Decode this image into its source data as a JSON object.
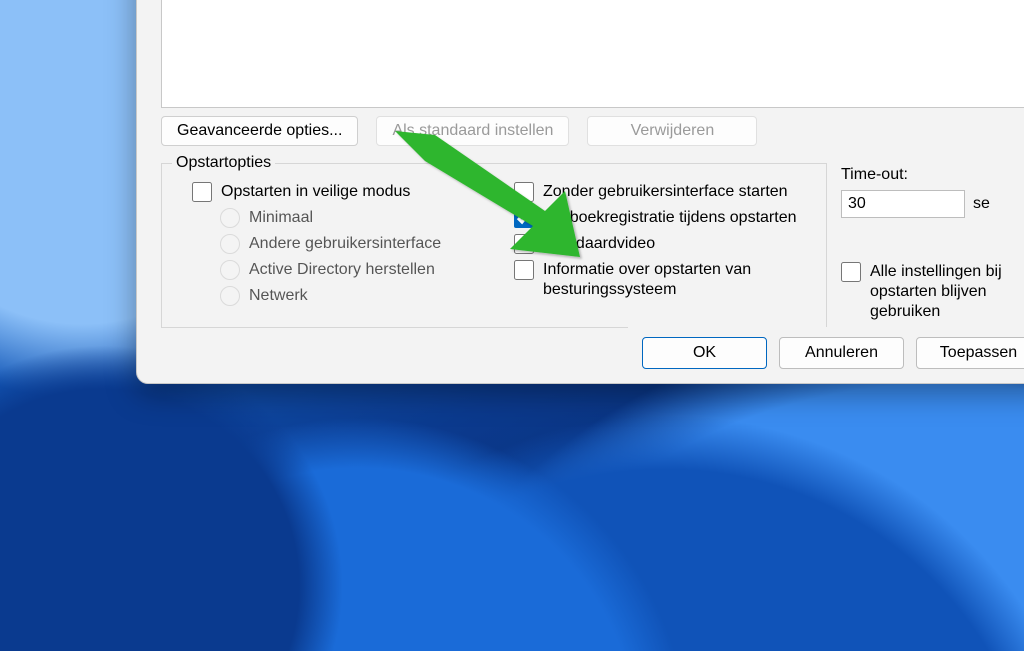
{
  "buttons": {
    "advanced": "Geavanceerde opties...",
    "set_default": "Als standaard instellen",
    "delete": "Verwijderen",
    "ok": "OK",
    "cancel": "Annuleren",
    "apply": "Toepassen"
  },
  "boot": {
    "legend": "Opstartopties",
    "safe_mode": "Opstarten in veilige modus",
    "minimal": "Minimaal",
    "altshell": "Andere gebruikersinterface",
    "ad_repair": "Active Directory herstellen",
    "network": "Netwerk",
    "no_gui": "Zonder gebruikersinterface starten",
    "boot_log": "Logboekregistratie tijdens opstarten",
    "base_video": "Standaardvideo",
    "os_boot_info": "Informatie over opstarten van besturingssysteem"
  },
  "timeout": {
    "label": "Time-out:",
    "value": "30",
    "unit": "se"
  },
  "persist": {
    "label": "Alle instellingen bij opstarten blijven gebruiken"
  },
  "state": {
    "safe_mode": false,
    "no_gui": false,
    "boot_log": true,
    "base_video": false,
    "os_boot_info": false,
    "persist": false,
    "set_default_disabled": true,
    "delete_disabled": true
  }
}
